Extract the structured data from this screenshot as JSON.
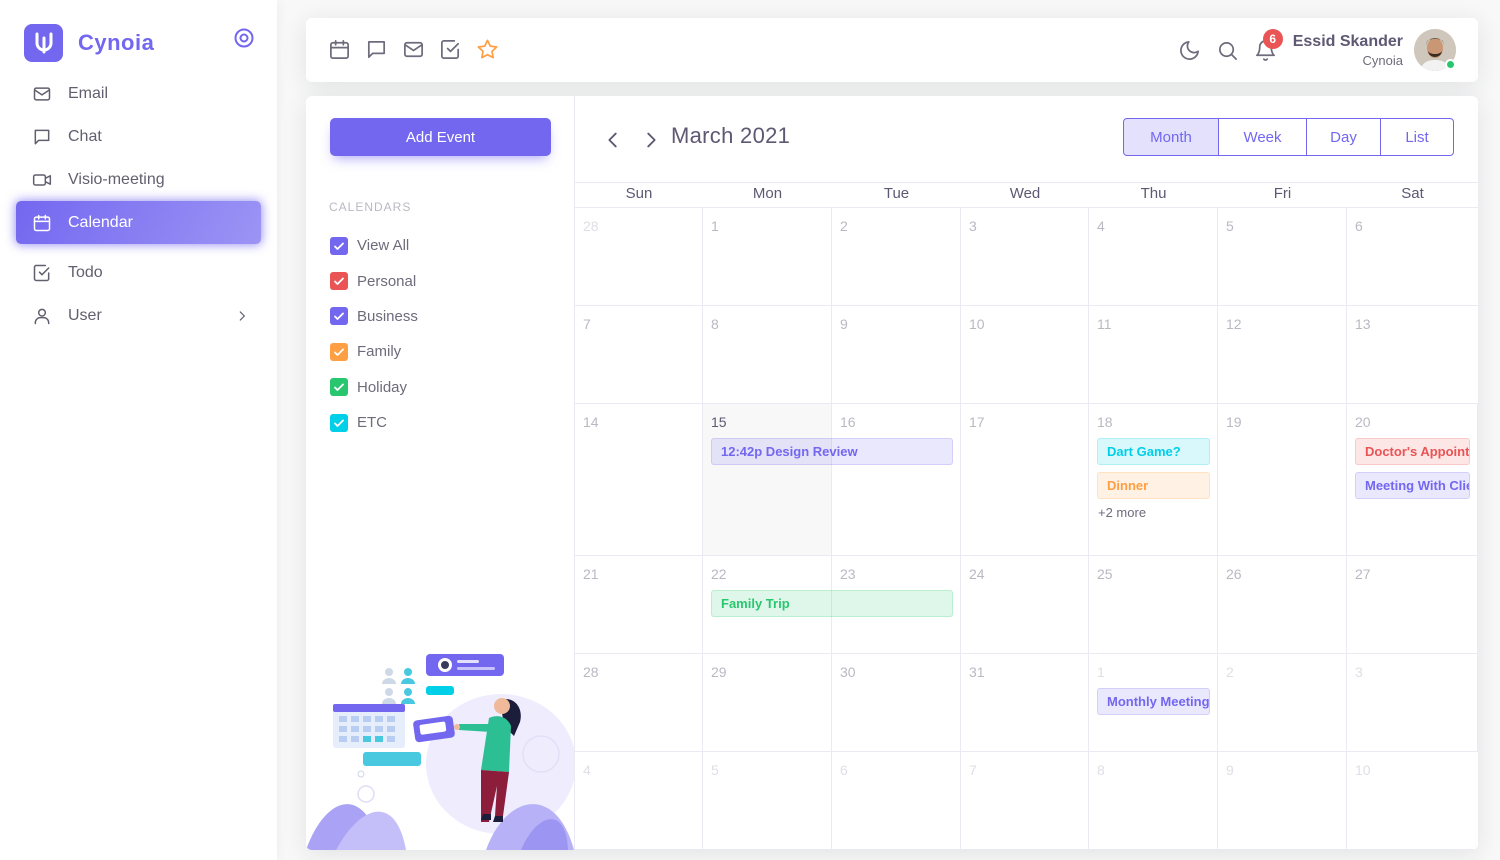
{
  "brand": {
    "name": "Cynoia"
  },
  "sidebar": {
    "items": [
      {
        "label": "Email",
        "icon": "mail-icon"
      },
      {
        "label": "Chat",
        "icon": "chat-icon"
      },
      {
        "label": "Visio-meeting",
        "icon": "video-icon"
      },
      {
        "label": "Calendar",
        "icon": "calendar-icon",
        "active": true
      },
      {
        "label": "Todo",
        "icon": "check-square-icon"
      },
      {
        "label": "User",
        "icon": "user-icon",
        "has_children": true
      }
    ]
  },
  "topbar": {
    "shortcuts": [
      "calendar-icon",
      "chat-icon",
      "mail-icon",
      "check-square-icon",
      "star-icon"
    ],
    "notifications_count": "6",
    "user": {
      "name": "Essid Skander",
      "org": "Cynoia",
      "status": "online"
    }
  },
  "calendar_app": {
    "add_event_label": "Add Event",
    "calendars_heading": "CALENDARS",
    "filters": [
      {
        "label": "View All",
        "color": "#7367f0",
        "checked": true
      },
      {
        "label": "Personal",
        "color": "#ea5455",
        "checked": true
      },
      {
        "label": "Business",
        "color": "#7367f0",
        "checked": true
      },
      {
        "label": "Family",
        "color": "#ff9f43",
        "checked": true
      },
      {
        "label": "Holiday",
        "color": "#28c76f",
        "checked": true
      },
      {
        "label": "ETC",
        "color": "#00cfe8",
        "checked": true
      }
    ],
    "title": "March 2021",
    "views": [
      "Month",
      "Week",
      "Day",
      "List"
    ],
    "active_view": "Month",
    "weekdays": [
      "Sun",
      "Mon",
      "Tue",
      "Wed",
      "Thu",
      "Fri",
      "Sat"
    ],
    "weeks": [
      [
        {
          "d": "28",
          "o": true
        },
        {
          "d": "1"
        },
        {
          "d": "2"
        },
        {
          "d": "3"
        },
        {
          "d": "4"
        },
        {
          "d": "5"
        },
        {
          "d": "6"
        }
      ],
      [
        {
          "d": "7"
        },
        {
          "d": "8"
        },
        {
          "d": "9"
        },
        {
          "d": "10"
        },
        {
          "d": "11"
        },
        {
          "d": "12"
        },
        {
          "d": "13"
        }
      ],
      [
        {
          "d": "14"
        },
        {
          "d": "15",
          "today": true
        },
        {
          "d": "16"
        },
        {
          "d": "17"
        },
        {
          "d": "18"
        },
        {
          "d": "19"
        },
        {
          "d": "20"
        }
      ],
      [
        {
          "d": "21"
        },
        {
          "d": "22"
        },
        {
          "d": "23"
        },
        {
          "d": "24"
        },
        {
          "d": "25"
        },
        {
          "d": "26"
        },
        {
          "d": "27"
        }
      ],
      [
        {
          "d": "28"
        },
        {
          "d": "29"
        },
        {
          "d": "30"
        },
        {
          "d": "31"
        },
        {
          "d": "1",
          "o": true
        },
        {
          "d": "2",
          "o": true
        },
        {
          "d": "3",
          "o": true
        }
      ],
      [
        {
          "d": "4",
          "o": true
        },
        {
          "d": "5",
          "o": true
        },
        {
          "d": "6",
          "o": true
        },
        {
          "d": "7",
          "o": true
        },
        {
          "d": "8",
          "o": true
        },
        {
          "d": "9",
          "o": true
        },
        {
          "d": "10",
          "o": true
        }
      ]
    ],
    "events": [
      {
        "week": 2,
        "day": 1,
        "span": 2,
        "slot": 0,
        "label": "12:42p  Design Review",
        "category": "business"
      },
      {
        "week": 2,
        "day": 4,
        "span": 1,
        "slot": 0,
        "label": "Dart Game?",
        "category": "etc"
      },
      {
        "week": 2,
        "day": 4,
        "span": 1,
        "slot": 1,
        "label": "Dinner",
        "category": "family"
      },
      {
        "week": 2,
        "day": 6,
        "span": 1,
        "slot": 0,
        "label": "Doctor's Appointment",
        "category": "personal"
      },
      {
        "week": 2,
        "day": 6,
        "span": 1,
        "slot": 1,
        "label": "Meeting With Client",
        "category": "business"
      },
      {
        "week": 3,
        "day": 1,
        "span": 2,
        "slot": 0,
        "label": "Family Trip",
        "category": "holiday"
      },
      {
        "week": 4,
        "day": 4,
        "span": 1,
        "slot": 0,
        "label": "Monthly Meeting",
        "category": "business"
      }
    ],
    "more_links": [
      {
        "week": 2,
        "day": 4,
        "label": "+2 more"
      }
    ]
  }
}
